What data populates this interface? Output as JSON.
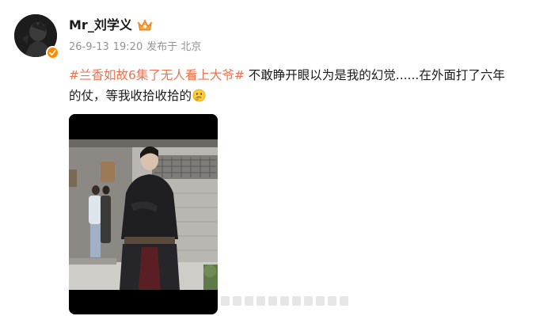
{
  "author": {
    "name": "Mr_刘学义",
    "avatar_icon": "avatar",
    "verified_icon": "verified-badge-icon",
    "member_icon": "vip-crown-icon"
  },
  "meta": {
    "date": "26-9-13",
    "time": "19:20",
    "location": "发布于 北京"
  },
  "post": {
    "hashtag": "#兰香如故6集了无人看上大爷#",
    "text_1": " 不敢睁开眼以为是我的幻觉......在外面打了六年",
    "text_2": "的仗，等我收拾收拾的",
    "emoji": "thinking-face-emoji"
  },
  "colors": {
    "hashtag": "#eb7350",
    "meta": "#939393",
    "badge": "#ff8a00"
  }
}
